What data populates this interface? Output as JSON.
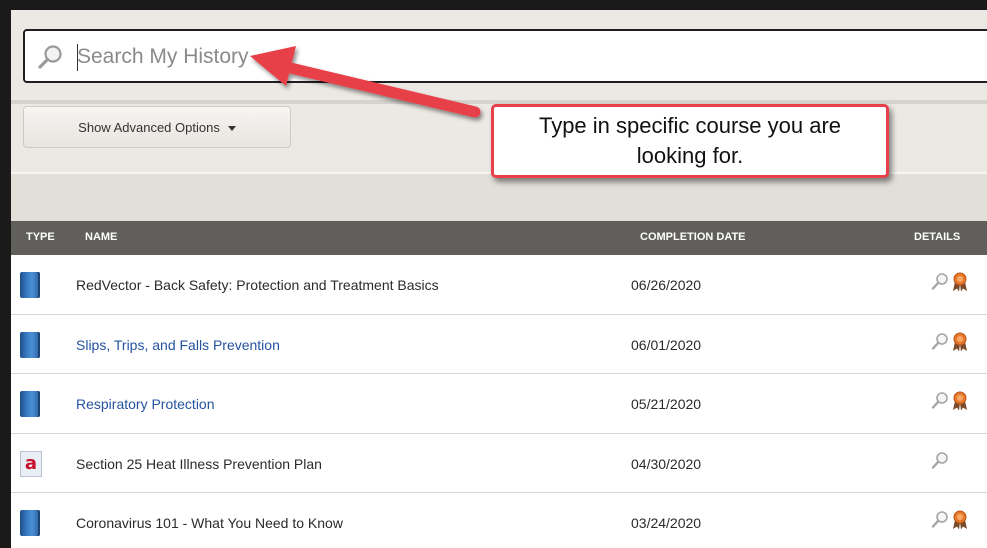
{
  "search": {
    "placeholder": "Search My History",
    "value": ""
  },
  "advanced_options": {
    "label": "Show Advanced Options"
  },
  "callout": {
    "text": "Type in specific course you are looking for."
  },
  "table": {
    "headers": {
      "type": "TYPE",
      "name": "NAME",
      "completion_date": "COMPLETION DATE",
      "details": "DETAILS"
    },
    "rows": [
      {
        "type_icon": "book-icon",
        "name": "RedVector - Back Safety: Protection and Treatment Basics",
        "name_is_link": false,
        "completion_date": "06/26/2020",
        "has_certificate": true
      },
      {
        "type_icon": "book-icon",
        "name": "Slips, Trips, and Falls Prevention",
        "name_is_link": true,
        "completion_date": "06/01/2020",
        "has_certificate": true
      },
      {
        "type_icon": "book-icon",
        "name": "Respiratory Protection",
        "name_is_link": true,
        "completion_date": "05/21/2020",
        "has_certificate": true
      },
      {
        "type_icon": "document-a-icon",
        "type_glyph": "a",
        "name": "Section 25 Heat Illness Prevention Plan",
        "name_is_link": false,
        "completion_date": "04/30/2020",
        "has_certificate": false
      },
      {
        "type_icon": "book-icon",
        "name": "Coronavirus 101 - What You Need to Know",
        "name_is_link": false,
        "completion_date": "03/24/2020",
        "has_certificate": true
      }
    ]
  },
  "colors": {
    "callout_border": "#e8404a",
    "arrow": "#e8404a",
    "header_bg": "#615f5b",
    "link": "#2553a0"
  }
}
